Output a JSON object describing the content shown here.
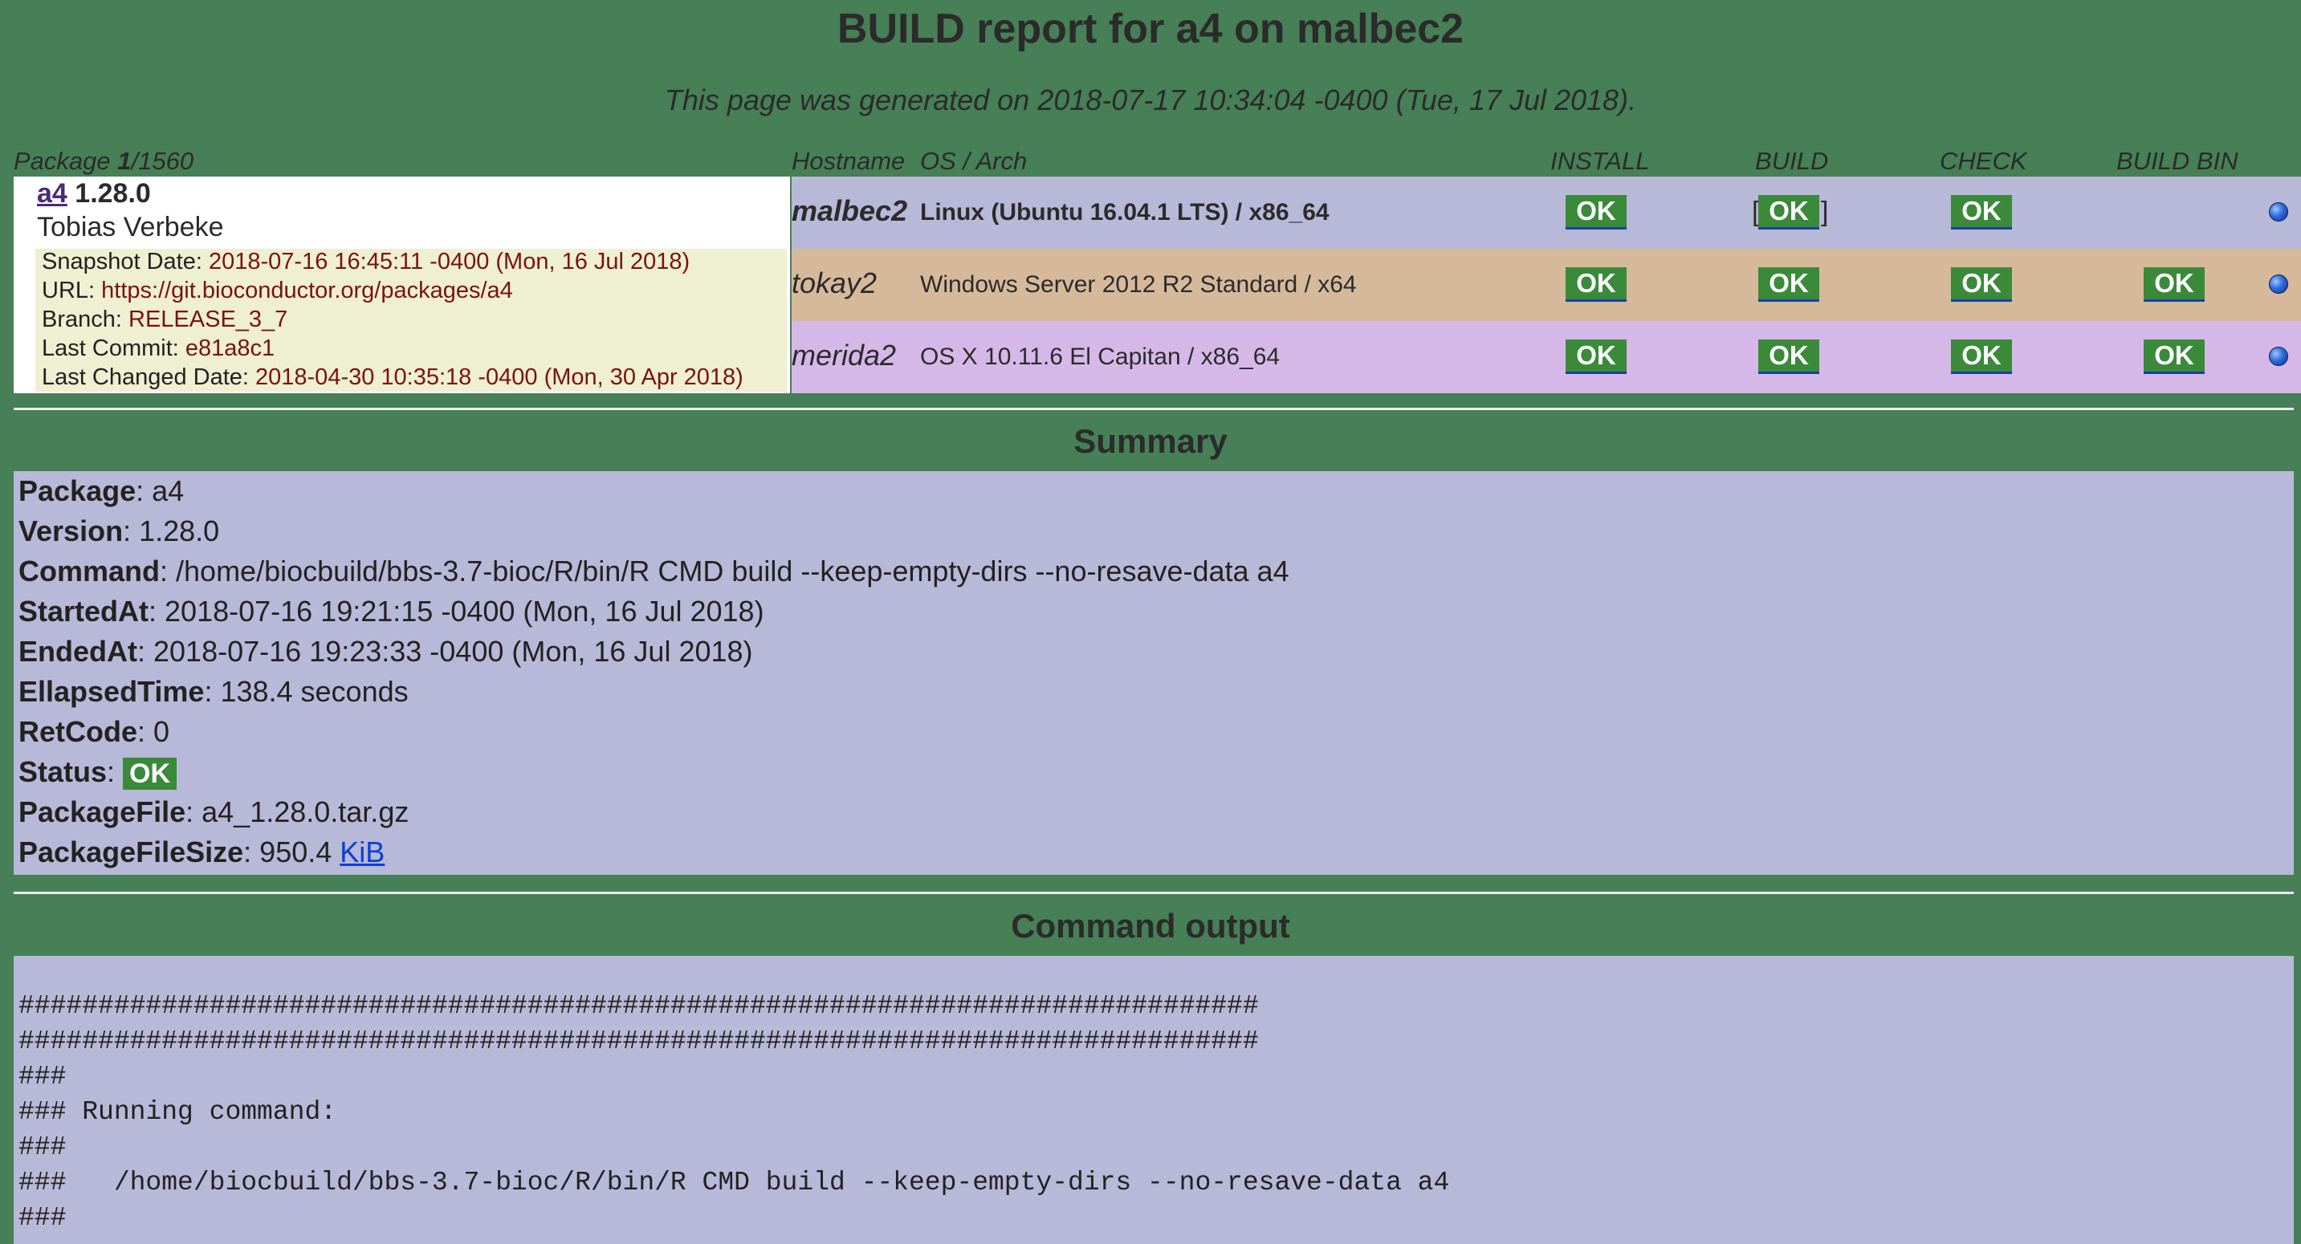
{
  "header": {
    "title": "BUILD report for a4 on malbec2",
    "subtitle": "This page was generated on 2018-07-17 10:34:04 -0400 (Tue, 17 Jul 2018)."
  },
  "columns": {
    "package_label": "Package ",
    "package_index": "1",
    "package_total": "/1560",
    "hostname": "Hostname",
    "os_arch": "OS / Arch",
    "install": "INSTALL",
    "build": "BUILD",
    "check": "CHECK",
    "build_bin": "BUILD BIN"
  },
  "package": {
    "name": "a4",
    "version": "1.28.0",
    "maintainer": "Tobias Verbeke",
    "meta": [
      {
        "label": "Snapshot Date: ",
        "value": "2018-07-16 16:45:11 -0400 (Mon, 16 Jul 2018)"
      },
      {
        "label": "URL: ",
        "value": "https://git.bioconductor.org/packages/a4"
      },
      {
        "label": "Branch: ",
        "value": "RELEASE_3_7"
      },
      {
        "label": "Last Commit: ",
        "value": "e81a8c1"
      },
      {
        "label": "Last Changed Date: ",
        "value": "2018-04-30 10:35:18 -0400 (Mon, 30 Apr 2018)"
      }
    ]
  },
  "hosts": [
    {
      "hostname": "malbec2",
      "os": "Linux (Ubuntu 16.04.1 LTS) / x86_64",
      "install": "OK",
      "build": "OK",
      "check": "OK",
      "build_bin": "",
      "bg": "#b8b8d8"
    },
    {
      "hostname": "tokay2",
      "os": "Windows Server 2012 R2 Standard / x64",
      "install": "OK",
      "build": "OK",
      "check": "OK",
      "build_bin": "OK",
      "bg": "#d6b99a"
    },
    {
      "hostname": "merida2",
      "os": "OS X 10.11.6 El Capitan / x86_64",
      "install": "OK",
      "build": "OK",
      "check": "OK",
      "build_bin": "OK",
      "bg": "#d6b8e8"
    }
  ],
  "bracket": {
    "open": "[",
    "close": "]"
  },
  "summary": {
    "heading": "Summary",
    "rows": [
      {
        "label": "Package",
        "value": ": a4"
      },
      {
        "label": "Version",
        "value": ": 1.28.0"
      },
      {
        "label": "Command",
        "value": ": /home/biocbuild/bbs-3.7-bioc/R/bin/R CMD build --keep-empty-dirs --no-resave-data a4"
      },
      {
        "label": "StartedAt",
        "value": ": 2018-07-16 19:21:15 -0400 (Mon, 16 Jul 2018)"
      },
      {
        "label": "EndedAt",
        "value": ": 2018-07-16 19:23:33 -0400 (Mon, 16 Jul 2018)"
      },
      {
        "label": "EllapsedTime",
        "value": ": 138.4 seconds"
      },
      {
        "label": "RetCode",
        "value": ": 0"
      }
    ],
    "status_label": "Status",
    "status_sep": ": ",
    "status_value": "OK",
    "file_label": "PackageFile",
    "file_value": ": a4_1.28.0.tar.gz",
    "size_label": "PackageFileSize",
    "size_value": ": 950.4 ",
    "size_unit": "KiB"
  },
  "output": {
    "heading": "Command output",
    "lines": [
      "##############################################################################",
      "##############################################################################",
      "###",
      "### Running command:",
      "###",
      "###   /home/biocbuild/bbs-3.7-bioc/R/bin/R CMD build --keep-empty-dirs --no-resave-data a4",
      "###"
    ]
  },
  "colors": {
    "page_bg": "#477f57",
    "ok_badge": "#3a8a3a",
    "panel_bg": "#b8b8d8",
    "link": "#0b3fd6",
    "meta_value": "#7a1212"
  },
  "icons": {
    "status_dot": "blue-ball-icon"
  }
}
